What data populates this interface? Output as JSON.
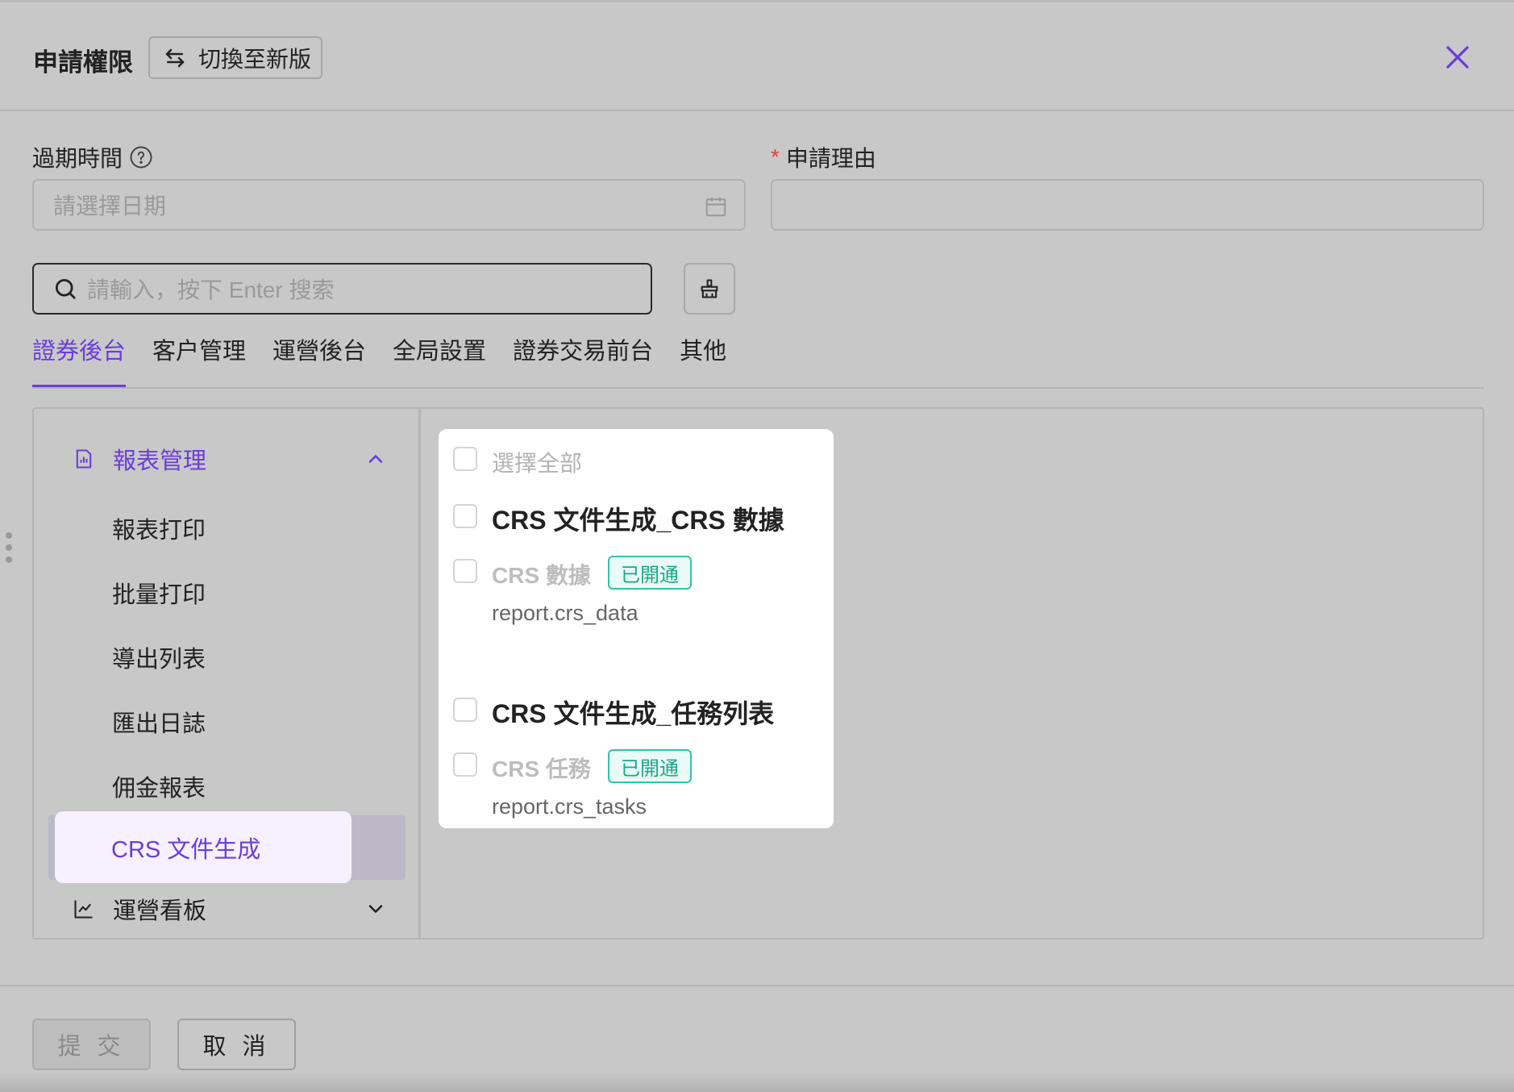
{
  "header": {
    "title": "申請權限",
    "switch_label": "切換至新版"
  },
  "form": {
    "expiry_label": "過期時間",
    "date_placeholder": "請選擇日期",
    "reason_label": "申請理由",
    "search_placeholder": "請輸入，按下 Enter 搜索"
  },
  "tabs": [
    "證券後台",
    "客户管理",
    "運營後台",
    "全局設置",
    "證券交易前台",
    "其他"
  ],
  "sidebar": {
    "group_reports": "報表管理",
    "items": [
      "報表打印",
      "批量打印",
      "導出列表",
      "匯出日誌",
      "佣金報表",
      "CRS 文件生成"
    ],
    "group_ops": "運營看板"
  },
  "permissions": {
    "select_all": "選擇全部",
    "sections": [
      {
        "title": "CRS 文件生成_CRS 數據",
        "item": "CRS 數據",
        "badge": "已開通",
        "code": "report.crs_data"
      },
      {
        "title": "CRS 文件生成_任務列表",
        "item": "CRS 任務",
        "badge": "已開通",
        "code": "report.crs_tasks"
      }
    ]
  },
  "footer": {
    "submit": "提 交",
    "cancel": "取 消"
  },
  "colors": {
    "accent": "#6a3ed8",
    "success": "#1aa886",
    "required": "#e0403a"
  }
}
